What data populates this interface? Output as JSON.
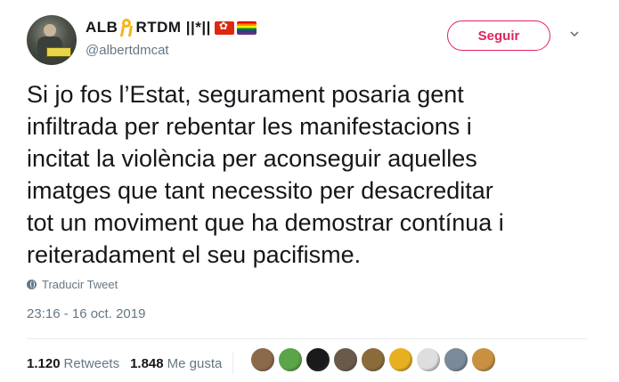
{
  "user": {
    "name_part1": "ALB",
    "name_part2": "RTDM ||*||",
    "handle": "@albertdmcat",
    "follow_label": "Seguir"
  },
  "tweet": {
    "text": "Si jo fos l’Estat, segurament posaria gent\ninfiltrada per rebentar les manifestacions i\nincitat la violència per aconseguir aquelles\nimatges que tant necessito per desacreditar\ntot un moviment que ha demostrar contínua i\nreiteradament el seu pacifisme.",
    "translate_label": "Traducir Tweet",
    "timestamp": "23:16 - 16 oct. 2019"
  },
  "stats": {
    "retweets_count": "1.120",
    "retweets_label": "Retweets",
    "likes_count": "1.848",
    "likes_label": "Me gusta"
  },
  "icons": {
    "ribbon": "yellow-ribbon-icon",
    "flag1": "hong-kong-flag-icon",
    "flag2": "rainbow-flag-icon",
    "translate": "globe-icon",
    "menu": "chevron-down-icon"
  },
  "colors": {
    "accent": "#e0245e",
    "secondary_text": "#657786",
    "primary_text": "#14171a",
    "ribbon": "#f2b619"
  },
  "liker_avatars": [
    "#8a6a4a",
    "#5aa548",
    "#1a1a1a",
    "#6a5a4a",
    "#8b6b3a",
    "#e8b020",
    "#dedede",
    "#7a8a9a",
    "#c89040"
  ]
}
